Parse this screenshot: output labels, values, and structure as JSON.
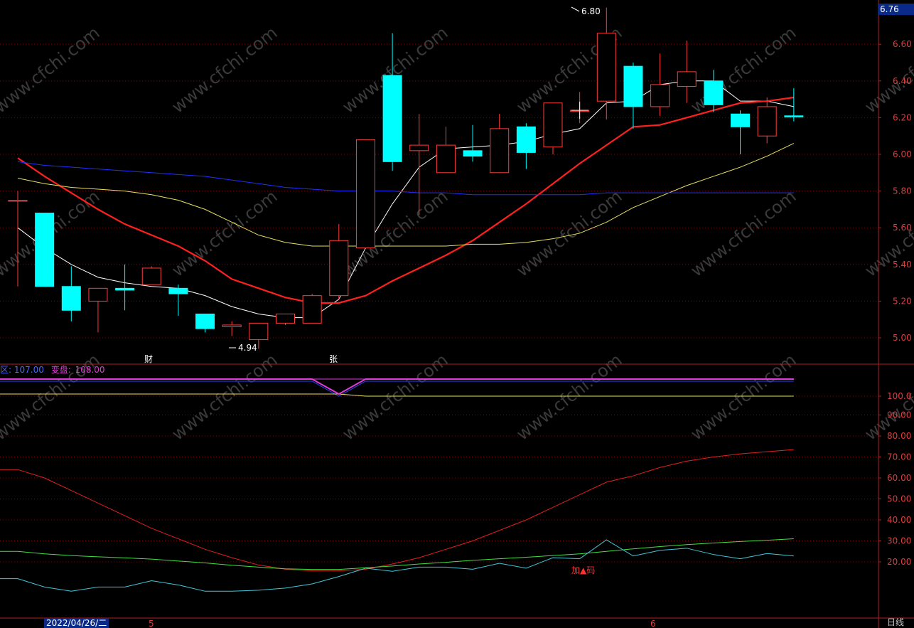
{
  "price_axis": {
    "current_price": "6.76",
    "ticks": [
      "6.60",
      "6.40",
      "6.20",
      "6.00",
      "5.80",
      "5.60",
      "5.40",
      "5.20",
      "5.00"
    ]
  },
  "indicator_axis": {
    "ticks": [
      "100.0",
      "90.00",
      "80.00",
      "70.00",
      "60.00",
      "50.00",
      "40.00",
      "30.00",
      "20.00"
    ]
  },
  "annotations": {
    "high_label": "6.80",
    "low_label": "4.94",
    "event_cai": "财",
    "event_zhang": "张",
    "chip_label": "加▲码"
  },
  "legend": {
    "item1": "区: 107.00",
    "item2_name": "变盘:",
    "item2_value": "108.00"
  },
  "x_axis": {
    "date_label": "2022/04/26/二",
    "month5": "5",
    "month6": "6",
    "period": "日线"
  },
  "colors": {
    "up": "#ff3c3c",
    "down": "#00ffff",
    "ma_white": "#ffffff",
    "ma_red": "#ff2020",
    "ma_yellow": "#e8e060",
    "ma_blue": "#2030ff"
  },
  "chart_data": [
    {
      "type": "candlestick",
      "title": "",
      "ylim": [
        4.9,
        6.85
      ],
      "candles": [
        {
          "o": 5.75,
          "h": 5.8,
          "l": 5.28,
          "c": 5.75,
          "dir": "up"
        },
        {
          "o": 5.68,
          "h": 5.68,
          "l": 5.28,
          "c": 5.28,
          "dir": "down"
        },
        {
          "o": 5.28,
          "h": 5.39,
          "l": 5.09,
          "c": 5.15,
          "dir": "down"
        },
        {
          "o": 5.2,
          "h": 5.27,
          "l": 5.03,
          "c": 5.27,
          "dir": "up"
        },
        {
          "o": 5.27,
          "h": 5.4,
          "l": 5.15,
          "c": 5.26,
          "dir": "down"
        },
        {
          "o": 5.29,
          "h": 5.39,
          "l": 5.29,
          "c": 5.38,
          "dir": "up"
        },
        {
          "o": 5.27,
          "h": 5.29,
          "l": 5.12,
          "c": 5.24,
          "dir": "down"
        },
        {
          "o": 5.13,
          "h": 5.13,
          "l": 5.03,
          "c": 5.05,
          "dir": "down"
        },
        {
          "o": 5.06,
          "h": 5.09,
          "l": 5.01,
          "c": 5.07,
          "dir": "up"
        },
        {
          "o": 4.99,
          "h": 5.08,
          "l": 4.94,
          "c": 5.08,
          "dir": "up"
        },
        {
          "o": 5.08,
          "h": 5.13,
          "l": 5.07,
          "c": 5.13,
          "dir": "up"
        },
        {
          "o": 5.08,
          "h": 5.24,
          "l": 5.08,
          "c": 5.23,
          "dir": "up"
        },
        {
          "o": 5.23,
          "h": 5.62,
          "l": 5.21,
          "c": 5.53,
          "dir": "up"
        },
        {
          "o": 5.49,
          "h": 6.08,
          "l": 5.49,
          "c": 6.08,
          "dir": "up"
        },
        {
          "o": 6.43,
          "h": 6.66,
          "l": 5.91,
          "c": 5.96,
          "dir": "down"
        },
        {
          "o": 6.02,
          "h": 6.22,
          "l": 5.67,
          "c": 6.05,
          "dir": "up"
        },
        {
          "o": 5.9,
          "h": 6.15,
          "l": 5.9,
          "c": 6.05,
          "dir": "up"
        },
        {
          "o": 5.99,
          "h": 6.16,
          "l": 5.96,
          "c": 6.02,
          "dir": "down"
        },
        {
          "o": 5.9,
          "h": 6.22,
          "l": 5.9,
          "c": 6.14,
          "dir": "up"
        },
        {
          "o": 6.15,
          "h": 6.17,
          "l": 5.92,
          "c": 6.01,
          "dir": "down"
        },
        {
          "o": 6.04,
          "h": 6.28,
          "l": 6.0,
          "c": 6.28,
          "dir": "up"
        },
        {
          "o": 6.24,
          "h": 6.34,
          "l": 6.17,
          "c": 6.24,
          "dir": "up"
        },
        {
          "o": 6.29,
          "h": 6.8,
          "l": 6.19,
          "c": 6.66,
          "dir": "up"
        },
        {
          "o": 6.48,
          "h": 6.5,
          "l": 6.14,
          "c": 6.26,
          "dir": "down"
        },
        {
          "o": 6.26,
          "h": 6.55,
          "l": 6.21,
          "c": 6.38,
          "dir": "up"
        },
        {
          "o": 6.37,
          "h": 6.62,
          "l": 6.28,
          "c": 6.45,
          "dir": "up"
        },
        {
          "o": 6.4,
          "h": 6.46,
          "l": 6.23,
          "c": 6.27,
          "dir": "down"
        },
        {
          "o": 6.22,
          "h": 6.24,
          "l": 6.0,
          "c": 6.15,
          "dir": "down"
        },
        {
          "o": 6.1,
          "h": 6.31,
          "l": 6.06,
          "c": 6.26,
          "dir": "up"
        },
        {
          "o": 6.21,
          "h": 6.36,
          "l": 6.18,
          "c": 6.21,
          "dir": "down"
        }
      ],
      "ma_series": [
        {
          "values": [
            5.6,
            5.49,
            5.4,
            5.33,
            5.3,
            5.28,
            5.27,
            5.23,
            5.17,
            5.13,
            5.11,
            5.11,
            5.21,
            5.49,
            5.73,
            5.93,
            6.03,
            6.04,
            6.05,
            6.07,
            6.11,
            6.14,
            6.28,
            6.29,
            6.38,
            6.4,
            6.4,
            6.29,
            6.29,
            6.26
          ]
        },
        {
          "values": [
            5.98,
            5.88,
            5.79,
            5.7,
            5.62,
            5.56,
            5.5,
            5.42,
            5.32,
            5.27,
            5.22,
            5.19,
            5.19,
            5.23,
            5.31,
            5.38,
            5.45,
            5.53,
            5.63,
            5.73,
            5.84,
            5.95,
            6.05,
            6.15,
            6.16,
            6.2,
            6.24,
            6.28,
            6.29,
            6.31
          ]
        },
        {
          "values": [
            5.87,
            5.84,
            5.82,
            5.81,
            5.8,
            5.78,
            5.75,
            5.7,
            5.63,
            5.56,
            5.52,
            5.5,
            5.5,
            5.5,
            5.5,
            5.5,
            5.5,
            5.51,
            5.51,
            5.52,
            5.54,
            5.57,
            5.63,
            5.71,
            5.77,
            5.83,
            5.88,
            5.93,
            5.99,
            6.06
          ]
        },
        {
          "values": [
            5.96,
            5.94,
            5.93,
            5.92,
            5.91,
            5.9,
            5.89,
            5.88,
            5.86,
            5.84,
            5.82,
            5.81,
            5.8,
            5.8,
            5.8,
            5.79,
            5.79,
            5.78,
            5.78,
            5.78,
            5.78,
            5.78,
            5.79,
            5.79,
            5.79,
            5.79,
            5.79,
            5.79,
            5.79,
            5.79
          ]
        }
      ]
    },
    {
      "type": "line",
      "ylim": [
        0,
        108
      ],
      "series": [
        {
          "values": [
            107.0,
            107.0,
            107.0,
            107.0,
            107.0,
            107.0,
            107.0,
            107.0,
            107.0,
            107.0,
            107.0,
            107.0,
            100.0,
            107.0,
            107.0,
            107.0,
            107.0,
            107.0,
            107.0,
            107.0,
            107.0,
            107.0,
            107.0,
            107.0,
            107.0,
            107.0,
            107.0,
            107.0,
            107.0,
            107.0
          ]
        },
        {
          "values": [
            108.0,
            108.0,
            108.0,
            108.0,
            108.0,
            108.0,
            108.0,
            108.0,
            108.0,
            108.0,
            108.0,
            108.0,
            108.0,
            108.0,
            108.0,
            108.0,
            108.0,
            108.0,
            108.0,
            108.0,
            108.0,
            108.0,
            108.0,
            108.0,
            108.0,
            108.0,
            108.0,
            108.0,
            108.0,
            108.0
          ]
        },
        {
          "values": [
            101.0,
            101.0,
            101.0,
            101.0,
            101.0,
            101.0,
            101.0,
            101.0,
            101.0,
            101.0,
            101.0,
            101.0,
            101.0,
            100.0,
            100.0,
            100.0,
            100.0,
            100.0,
            100.0,
            100.0,
            100.0,
            100.0,
            100.0,
            100.0,
            100.0,
            100.0,
            100.0,
            100.0,
            100.0,
            100.0
          ]
        },
        {
          "values": [
            108.0,
            108.0,
            108.0,
            108.0,
            108.0,
            108.0,
            108.0,
            108.0,
            108.0,
            108.0,
            108.0,
            108.0,
            101.0,
            108.0,
            108.0,
            108.0,
            108.0,
            108.0,
            108.0,
            108.0,
            108.0,
            108.0,
            108.0,
            108.0,
            108.0,
            108.0,
            108.0,
            108.0,
            108.0,
            108.0
          ]
        }
      ]
    },
    {
      "type": "line",
      "ylim": [
        5,
        100
      ],
      "series": [
        {
          "values": [
            64,
            60,
            54,
            48,
            42,
            36,
            31,
            26,
            22,
            18.5,
            16.5,
            15.7,
            15.7,
            16.5,
            19,
            22,
            26,
            30,
            35,
            40,
            46,
            52,
            58,
            61,
            65,
            68,
            70,
            71.5,
            72.5,
            73.5
          ]
        },
        {
          "values": [
            25,
            23.8,
            23,
            22.4,
            21.9,
            21.3,
            20.4,
            19.5,
            18.4,
            17.5,
            16.7,
            16.4,
            16.4,
            17.2,
            18,
            19,
            19.8,
            20.7,
            21.5,
            22.2,
            23,
            23.8,
            25,
            26.2,
            27.3,
            28.2,
            29,
            29.7,
            30.3,
            31
          ]
        },
        {
          "values": [
            12,
            8,
            6,
            8,
            8,
            11,
            9,
            6,
            6,
            6.5,
            7.5,
            9.5,
            13,
            17,
            15.5,
            17.5,
            17.5,
            16.5,
            19.3,
            17,
            22,
            21.5,
            30.5,
            22.8,
            25.5,
            26.5,
            23.5,
            21.5,
            24,
            22.8
          ]
        }
      ]
    }
  ]
}
